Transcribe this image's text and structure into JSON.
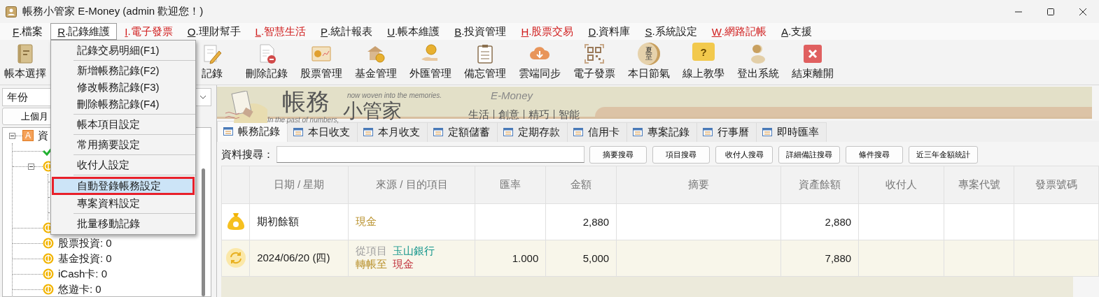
{
  "window": {
    "title": "帳務小管家 E-Money (admin 歡迎您！)"
  },
  "menu_bar": [
    {
      "label": "F.檔案",
      "color": "#1a1a1a",
      "selected": false
    },
    {
      "label": "R.記錄維護",
      "color": "#1a1a1a",
      "selected": true
    },
    {
      "label": "I.電子發票",
      "color": "#d01c1c",
      "selected": false
    },
    {
      "label": "O.理財幫手",
      "color": "#1a1a1a",
      "selected": false
    },
    {
      "label": "L.智慧生活",
      "color": "#d01c1c",
      "selected": false
    },
    {
      "label": "P.統計報表",
      "color": "#1a1a1a",
      "selected": false
    },
    {
      "label": "U.帳本維護",
      "color": "#1a1a1a",
      "selected": false
    },
    {
      "label": "B.投資管理",
      "color": "#1a1a1a",
      "selected": false
    },
    {
      "label": "H.股票交易",
      "color": "#d01c1c",
      "selected": false
    },
    {
      "label": "D.資料庫",
      "color": "#1a1a1a",
      "selected": false
    },
    {
      "label": "S.系統設定",
      "color": "#1a1a1a",
      "selected": false
    },
    {
      "label": "W.網路記帳",
      "color": "#d01c1c",
      "selected": false
    },
    {
      "label": "A.支援",
      "color": "#1a1a1a",
      "selected": false
    }
  ],
  "toolbar": [
    {
      "label": "帳本選擇",
      "kind": "ledger"
    },
    {
      "label": "記錄",
      "kind": "pencil"
    },
    {
      "label": "刪除記錄",
      "kind": "delete-doc"
    },
    {
      "label": "股票管理",
      "kind": "stock"
    },
    {
      "label": "基金管理",
      "kind": "fund"
    },
    {
      "label": "外匯管理",
      "kind": "forex"
    },
    {
      "label": "備忘管理",
      "kind": "memo"
    },
    {
      "label": "雲端同步",
      "kind": "cloud"
    },
    {
      "label": "電子發票",
      "kind": "qr"
    },
    {
      "label": "本日節氣",
      "kind": "solar-term",
      "badge": "夏至"
    },
    {
      "label": "線上教學",
      "kind": "help",
      "badge": "?"
    },
    {
      "label": "登出系統",
      "kind": "user"
    },
    {
      "label": "結束離開",
      "kind": "exit"
    }
  ],
  "dropdown_menu": {
    "items": [
      {
        "kind": "item",
        "label": "記錄交易明細(F1)",
        "selected": false
      },
      {
        "kind": "separator"
      },
      {
        "kind": "item",
        "label": "新增帳務記錄(F2)",
        "selected": false
      },
      {
        "kind": "item",
        "label": "修改帳務記錄(F3)",
        "selected": false
      },
      {
        "kind": "item",
        "label": "刪除帳務記錄(F4)",
        "selected": false
      },
      {
        "kind": "separator"
      },
      {
        "kind": "item",
        "label": "帳本項目設定",
        "selected": false
      },
      {
        "kind": "separator"
      },
      {
        "kind": "item",
        "label": "常用摘要設定",
        "selected": false
      },
      {
        "kind": "separator"
      },
      {
        "kind": "item",
        "label": "收付人設定",
        "selected": false
      },
      {
        "kind": "separator"
      },
      {
        "kind": "item",
        "label": "自動登錄帳務設定",
        "selected": true
      },
      {
        "kind": "item",
        "label": "專案資料設定",
        "selected": false
      },
      {
        "kind": "separator"
      },
      {
        "kind": "item",
        "label": "批量移動記錄",
        "selected": false
      }
    ]
  },
  "left_panel": {
    "year_select": {
      "value": "年份"
    },
    "prev_month_button": "上個月",
    "tree": [
      {
        "label": "資",
        "kind": "letter",
        "badge": "A",
        "expanded": true,
        "children": [
          {
            "kind": "check"
          },
          {
            "kind": "coin",
            "expanded": true,
            "children": [
              {
                "kind": "leaf"
              },
              {
                "kind": "leaf"
              },
              {
                "kind": "leaf"
              }
            ]
          },
          {
            "kind": "coin"
          },
          {
            "kind": "coin",
            "label": "股票投資: 0"
          },
          {
            "kind": "coin",
            "label": "基金投資: 0"
          },
          {
            "kind": "coin",
            "label": "iCash卡: 0"
          },
          {
            "kind": "coin",
            "label": "悠遊卡: 0"
          }
        ]
      }
    ]
  },
  "banner": {
    "title": "帳務",
    "subtitle": "小管家",
    "motto_top": "now woven into the memories.",
    "motto_bottom": "In the past of numbers,",
    "brand": "E-Money",
    "tagline": [
      "生活",
      "創意",
      "精巧",
      "智能"
    ]
  },
  "tabs": [
    {
      "label": "帳務記錄",
      "selected": true
    },
    {
      "label": "本日收支",
      "selected": false
    },
    {
      "label": "本月收支",
      "selected": false
    },
    {
      "label": "定額儲蓄",
      "selected": false
    },
    {
      "label": "定期存款",
      "selected": false
    },
    {
      "label": "信用卡",
      "selected": false
    },
    {
      "label": "專案記錄",
      "selected": false
    },
    {
      "label": "行事曆",
      "selected": false
    },
    {
      "label": "即時匯率",
      "selected": false
    }
  ],
  "search": {
    "label": "資料搜尋：",
    "buttons": [
      "摘要搜尋",
      "項目搜尋",
      "收付人搜尋",
      "詳細備註搜尋",
      "條件搜尋",
      "近三年金額統計"
    ]
  },
  "table": {
    "columns": [
      "日期 / 星期",
      "來源 / 目的項目",
      "匯率",
      "金額",
      "摘要",
      "資產餘額",
      "收付人",
      "專案代號",
      "發票號碼"
    ],
    "rows": [
      {
        "kind": "opening",
        "date": "期初餘額",
        "source": [
          [
            {
              "text": "現金",
              "color": "#b8902a"
            }
          ]
        ],
        "amount": "2,880",
        "balance": "2,880"
      },
      {
        "kind": "transfer",
        "date": "2024/06/20 (四)",
        "source": [
          [
            {
              "text": "從項目",
              "color": "#a0a0a0"
            },
            {
              "text": "玉山銀行",
              "color": "#14968c"
            }
          ],
          [
            {
              "text": "轉帳至",
              "color": "#b8902a"
            },
            {
              "text": "現金",
              "color": "#c0303a"
            }
          ]
        ],
        "rate": "1.000",
        "amount": "5,000",
        "balance": "7,880"
      }
    ]
  }
}
